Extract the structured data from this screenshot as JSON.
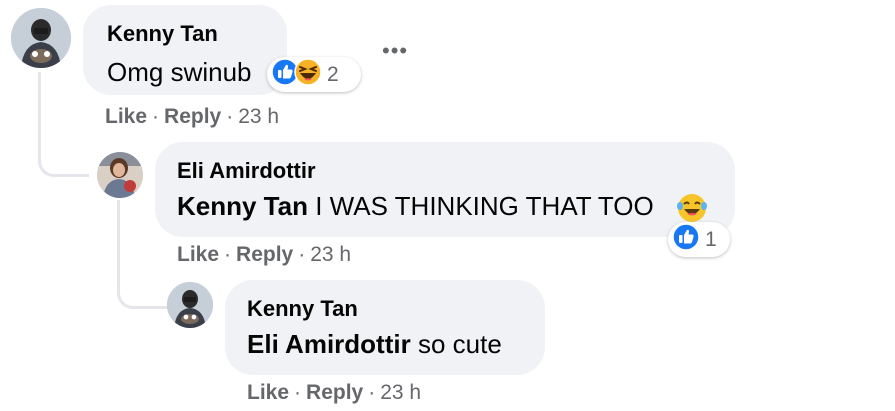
{
  "comments": [
    {
      "author": "Kenny Tan",
      "text": "Omg swinub",
      "actions": {
        "like": "Like",
        "reply": "Reply",
        "time": "23 h"
      },
      "reactions": {
        "icons": [
          "like-icon",
          "haha-icon"
        ],
        "count": "2"
      },
      "more_label": "•••"
    },
    {
      "author": "Eli Amirdottir",
      "mention": "Kenny Tan",
      "text": "I WAS THINKING THAT TOO",
      "emoji": "laughing-tears-emoji",
      "actions": {
        "like": "Like",
        "reply": "Reply",
        "time": "23 h"
      },
      "reactions": {
        "icons": [
          "like-icon"
        ],
        "count": "1"
      }
    },
    {
      "author": "Kenny Tan",
      "mention": "Eli Amirdottir",
      "text": "so cute",
      "actions": {
        "like": "Like",
        "reply": "Reply",
        "time": "23 h"
      }
    }
  ],
  "separator": "·",
  "colors": {
    "bubble": "#f0f2f5",
    "like_blue": "#1877f2",
    "haha_yellow": "#f7b125",
    "meta_gray": "#65676b"
  }
}
